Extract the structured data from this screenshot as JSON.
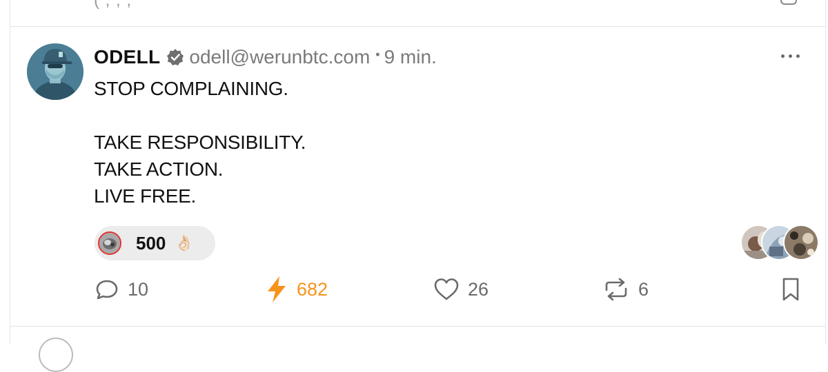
{
  "previous_post": {
    "fragment": "(                    ,         ,                         ,"
  },
  "post": {
    "author": {
      "name": "ODELL",
      "verified": true,
      "handle": "odell@werunbtc.com"
    },
    "separator": "•",
    "time": "9 min.",
    "lines": [
      "STOP COMPLAINING.",
      "",
      "TAKE RESPONSIBILITY.",
      "TAKE ACTION.",
      "LIVE FREE."
    ],
    "top_zap": {
      "amount": "500",
      "emoji": "👌🏻"
    },
    "actions": {
      "replies": "10",
      "zaps": "682",
      "likes": "26",
      "reposts": "6"
    }
  },
  "colors": {
    "zap_accent": "#f7931a",
    "zapper_ring": "#e0332e",
    "muted_text": "#7a7a7a",
    "pill_background": "#ececec"
  },
  "icons": {
    "verified": "verified-badge-icon",
    "more": "more-options-icon",
    "reply": "speech-bubble-icon",
    "zap": "lightning-bolt-icon",
    "like": "heart-icon",
    "repost": "repost-arrows-icon",
    "bookmark": "bookmark-icon"
  }
}
